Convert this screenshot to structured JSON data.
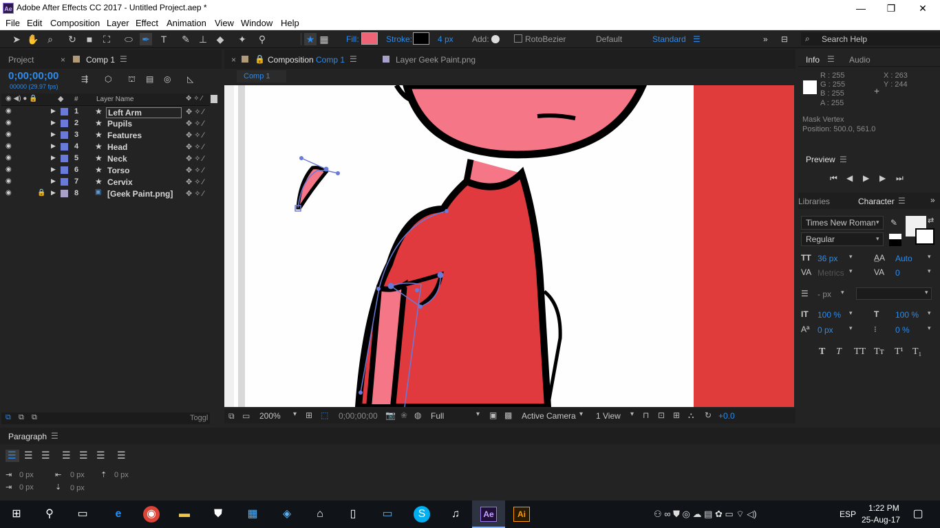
{
  "window": {
    "title": "Adobe After Effects CC 2017 - Untitled Project.aep *",
    "logo": "Ae"
  },
  "window_controls": [
    "—",
    "❐",
    "✕"
  ],
  "menu": [
    "File",
    "Edit",
    "Composition",
    "Layer",
    "Effect",
    "Animation",
    "View",
    "Window",
    "Help"
  ],
  "toolbar": {
    "fill_label": "Fill:",
    "stroke_label": "Stroke:",
    "stroke_width": "4 px",
    "add_label": "Add:",
    "rotobezier": "RotoBezier",
    "workspace_default": "Default",
    "workspace_standard": "Standard",
    "search_placeholder": "Search Help",
    "fill_color": "#f06478"
  },
  "project_panel": {
    "tab_project": "Project",
    "tab_comp": "Comp 1",
    "timecode": "0;00;00;00",
    "timecode_sub": "00000 (29.97 fps)",
    "col_num": "#",
    "col_name": "Layer Name",
    "toggle_label": "Toggl",
    "layers": [
      {
        "num": "1",
        "name": "Left Arm"
      },
      {
        "num": "2",
        "name": "Pupils"
      },
      {
        "num": "3",
        "name": "Features"
      },
      {
        "num": "4",
        "name": "Head"
      },
      {
        "num": "5",
        "name": "Neck"
      },
      {
        "num": "6",
        "name": "Torso"
      },
      {
        "num": "7",
        "name": "Cervix"
      },
      {
        "num": "8",
        "name": "[Geek Paint.png]"
      }
    ]
  },
  "viewer": {
    "tab_composition_prefix": "Composition",
    "tab_composition_name": "Comp 1",
    "tab_layer": "Layer  Geek Paint.png",
    "breadcrumb": "Comp 1",
    "zoom": "200%",
    "timecode": "0;00;00;00",
    "resolution": "Full",
    "camera": "Active Camera",
    "views": "1 View",
    "exposure": "+0.0"
  },
  "info_panel": {
    "tab_info": "Info",
    "tab_audio": "Audio",
    "r": "R : 255",
    "g": "G : 255",
    "b": "B : 255",
    "a": "A : 255",
    "x": "X : 263",
    "y": "Y : 244",
    "mask_vertex": "Mask Vertex",
    "position": "Position: 500.0, 561.0"
  },
  "preview_panel": {
    "title": "Preview"
  },
  "character_panel": {
    "tab_libraries": "Libraries",
    "tab_character": "Character",
    "font": "Times New Roman",
    "style": "Regular",
    "size": "36 px",
    "leading": "Auto",
    "kerning": "Metrics",
    "tracking": "0",
    "stroke_width": "- px",
    "vscale": "100 %",
    "hscale": "100 %",
    "baseline": "0 px",
    "tsume": "0 %",
    "styles": [
      "T",
      "T",
      "TT",
      "Tт",
      "T¹",
      "T₁"
    ]
  },
  "paragraph_panel": {
    "title": "Paragraph",
    "indent_left": "0 px",
    "indent_right": "0 px",
    "space_before": "0 px",
    "first_line": "0 px",
    "space_after": "0 px"
  },
  "taskbar": {
    "lang": "ESP",
    "time": "1:22 PM",
    "date": "25-Aug-17",
    "ae": "Ae",
    "ai": "Ai"
  }
}
